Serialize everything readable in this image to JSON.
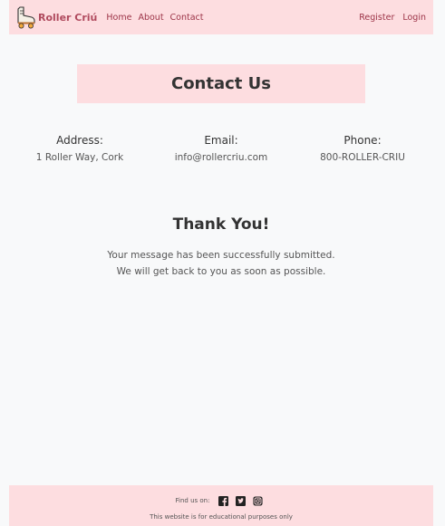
{
  "navbar": {
    "brand": "Roller Criú",
    "links": [
      "Home",
      "About",
      "Contact"
    ],
    "auth": [
      "Register",
      "Login"
    ],
    "icon": "roller-skate-icon"
  },
  "contact": {
    "title": "Contact Us"
  },
  "info": {
    "address_label": "Address:",
    "address_value": "1 Roller Way, Cork",
    "email_label": "Email:",
    "email_value": "info@rollercriu.com",
    "phone_label": "Phone:",
    "phone_value": "800-ROLLER-CRIU"
  },
  "thanks": {
    "title": "Thank You!",
    "line1": "Your message has been successfully submitted.",
    "line2": "We will get back to you as soon as possible."
  },
  "footer": {
    "find_us": "Find us on:",
    "social_icons": [
      "facebook-icon",
      "twitter-icon",
      "instagram-icon"
    ],
    "disclaimer": "This website is for educational purposes only"
  },
  "colors": {
    "nav_bg": "#fddde0",
    "link": "#9c3347",
    "page_bg": "#f8f9fa"
  }
}
